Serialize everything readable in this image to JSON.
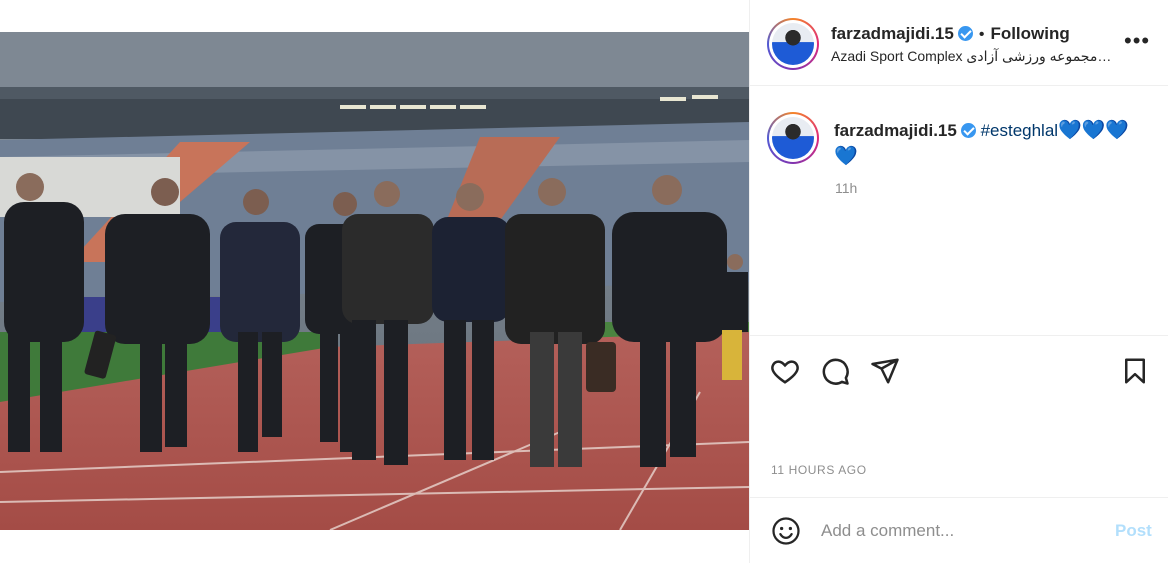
{
  "header": {
    "username": "farzadmajidi.15",
    "follow_status": "Following",
    "separator": "•",
    "location": "Azadi Sport Complex مجموعه ورزشی آزادی…",
    "more_label": "•••"
  },
  "caption": {
    "username": "farzadmajidi.15",
    "hashtag": "#esteghlal",
    "hearts": "💙💙💙",
    "hearts_line2": "💙",
    "time": "11h"
  },
  "actions": {
    "timestamp": "11 HOURS AGO",
    "icons": [
      "heart-icon",
      "comment-icon",
      "share-icon",
      "bookmark-icon"
    ]
  },
  "comment_box": {
    "placeholder": "Add a comment...",
    "post_label": "Post"
  },
  "colors": {
    "verified": "#3897f0",
    "hashtag": "#00376b",
    "post_disabled": "#b2dffc",
    "track": "#b5504a"
  }
}
